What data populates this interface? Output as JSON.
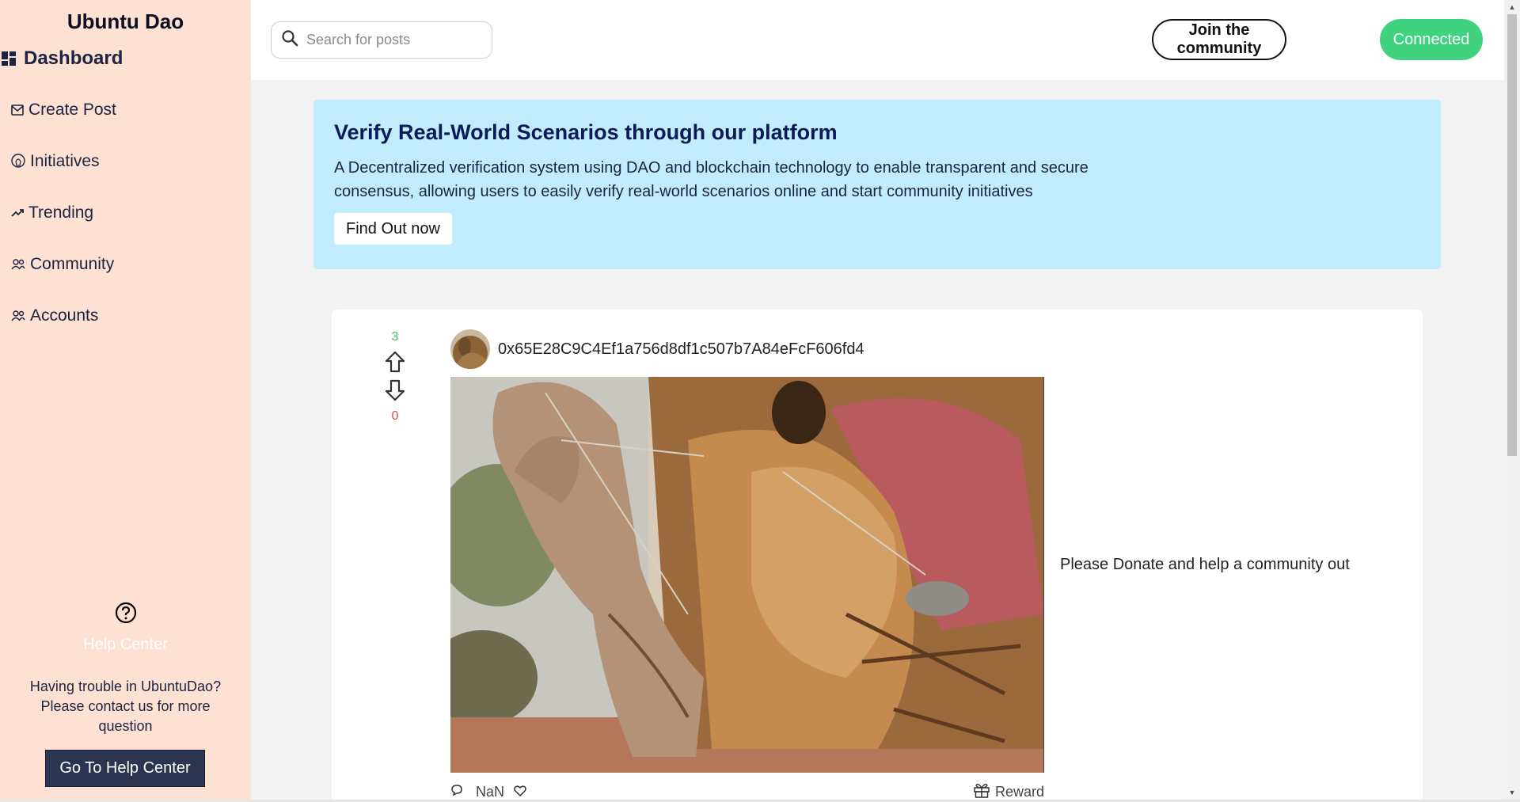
{
  "sidebar": {
    "brand": "Ubuntu Dao",
    "dashboard_label": "Dashboard",
    "items": [
      {
        "label": "Create Post",
        "icon": "mail-icon"
      },
      {
        "label": "Initiatives",
        "icon": "bulb-icon"
      },
      {
        "label": "Trending",
        "icon": "trending-icon"
      },
      {
        "label": "Community",
        "icon": "users-icon"
      },
      {
        "label": "Accounts",
        "icon": "users-icon"
      }
    ],
    "help": {
      "title": "Help Center",
      "text": "Having trouble in UbuntuDao? Please contact us for more question",
      "button": "Go To Help Center"
    }
  },
  "header": {
    "search_placeholder": "Search for posts",
    "join_label": "Join the community",
    "connected_label": "Connected"
  },
  "banner": {
    "title": "Verify Real-World Scenarios through our platform",
    "description": "A Decentralized verification system using DAO and blockchain technology to enable transparent and secure consensus, allowing users to easily verify real-world scenarios online and start community initiatives",
    "button": "Find Out now"
  },
  "post": {
    "upvotes": "3",
    "downvotes": "0",
    "author": "0x65E28C9C4Ef1a756d8df1c507b7A84eFcF606fd4",
    "text": "Please Donate and help a community out",
    "comments": "NaN",
    "reward_label": "Reward"
  },
  "colors": {
    "sidebar_bg": "#fde1d3",
    "banner_bg": "#c0ecfb",
    "connected": "#3fd37f",
    "upvote": "#3fbf5f",
    "downvote": "#e0473e"
  }
}
